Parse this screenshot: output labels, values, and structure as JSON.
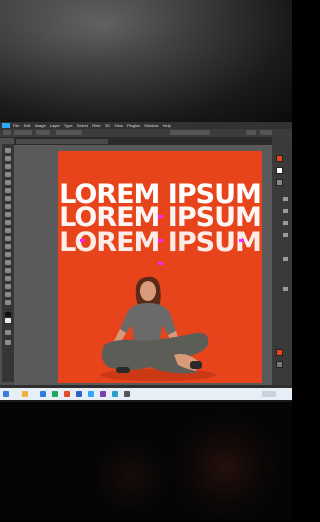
{
  "menubar": {
    "items": [
      "File",
      "Edit",
      "Image",
      "Layer",
      "Type",
      "Select",
      "Filter",
      "3D",
      "View",
      "Plugins",
      "Window",
      "Help"
    ]
  },
  "poster": {
    "line1": "LOREM IPSUM",
    "line2": "LOREM IPSUM",
    "line3": "LOREM IPSUM",
    "background_color": "#e8441c"
  },
  "colors": {
    "selection_handle": "#ff20ff",
    "photoshop_accent": "#31a8ff"
  },
  "icons": [
    "photoshop-logo",
    "move-tool-icon",
    "windows-start-icon"
  ]
}
